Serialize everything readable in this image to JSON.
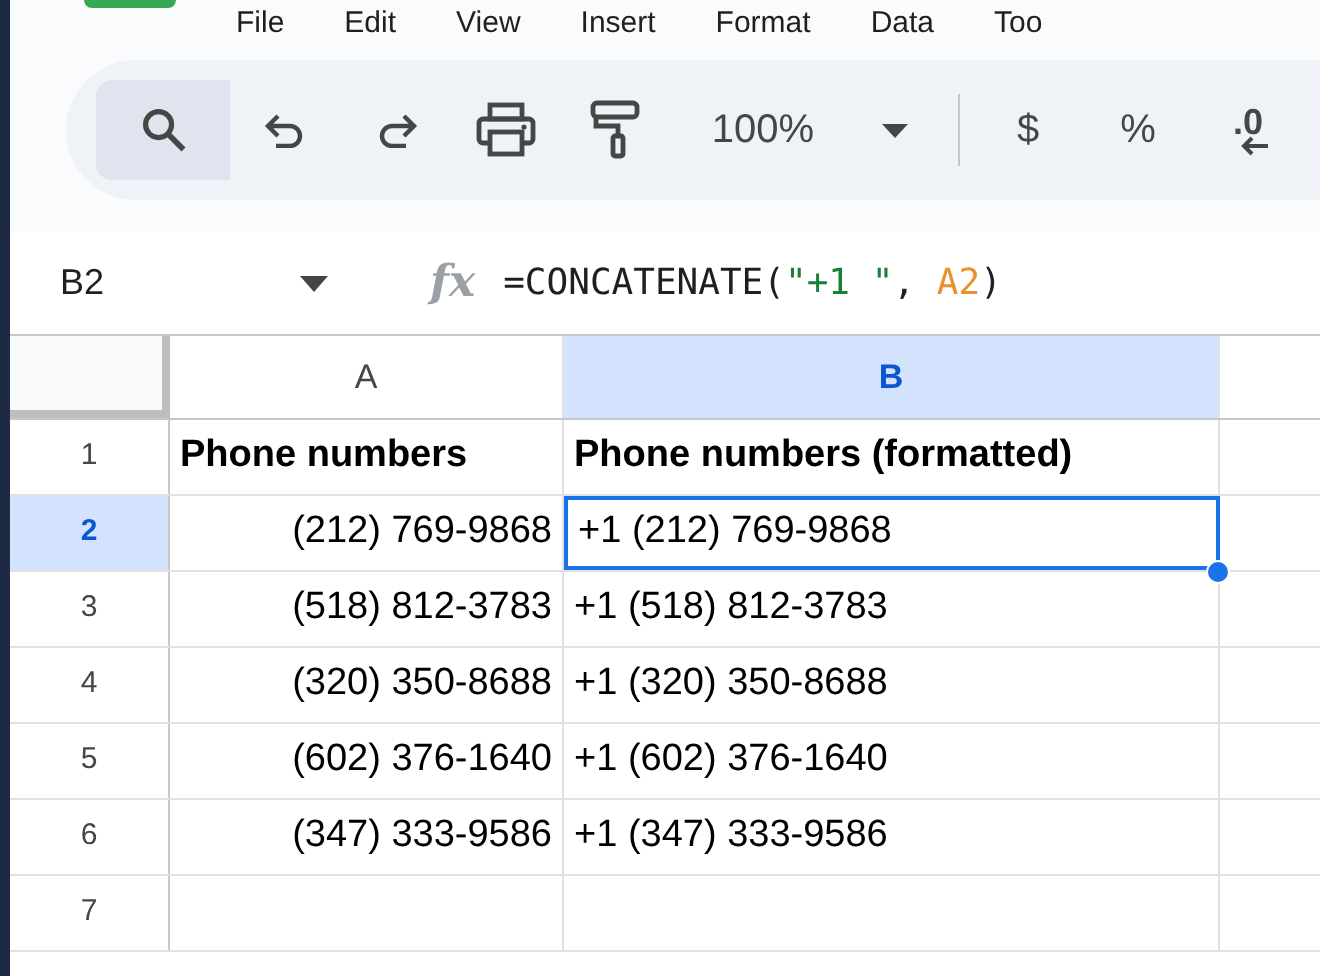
{
  "menu": [
    "File",
    "Edit",
    "View",
    "Insert",
    "Format",
    "Data",
    "Too"
  ],
  "toolbar": {
    "search": {
      "selected": true
    },
    "zoom": "100%",
    "currency": "$",
    "percent": "%",
    "decimal": ".0"
  },
  "name_box": "B2",
  "fx_label": "fx",
  "formula": [
    {
      "text": "=CONCATENATE(",
      "kind": "plain"
    },
    {
      "text": "\"+1 \"",
      "kind": "string"
    },
    {
      "text": ", ",
      "kind": "plain"
    },
    {
      "text": "A2",
      "kind": "reference"
    },
    {
      "text": ")",
      "kind": "plain"
    }
  ],
  "columns": [
    {
      "label": "A",
      "selected": false
    },
    {
      "label": "B",
      "selected": true
    }
  ],
  "rows": [
    {
      "label": "1",
      "selected": false,
      "cells": [
        {
          "text": "Phone numbers",
          "kind": "header",
          "selected": false
        },
        {
          "text": "Phone numbers (formatted)",
          "kind": "header",
          "selected": false
        }
      ]
    },
    {
      "label": "2",
      "selected": true,
      "cells": [
        {
          "text": "(212) 769-9868",
          "kind": "number",
          "selected": false
        },
        {
          "text": "+1 (212) 769-9868",
          "kind": "text",
          "selected": true
        }
      ]
    },
    {
      "label": "3",
      "selected": false,
      "cells": [
        {
          "text": "(518) 812-3783",
          "kind": "number",
          "selected": false
        },
        {
          "text": "+1 (518) 812-3783",
          "kind": "text",
          "selected": false
        }
      ]
    },
    {
      "label": "4",
      "selected": false,
      "cells": [
        {
          "text": "(320) 350-8688",
          "kind": "number",
          "selected": false
        },
        {
          "text": "+1 (320) 350-8688",
          "kind": "text",
          "selected": false
        }
      ]
    },
    {
      "label": "5",
      "selected": false,
      "cells": [
        {
          "text": "(602) 376-1640",
          "kind": "number",
          "selected": false
        },
        {
          "text": "+1 (602) 376-1640",
          "kind": "text",
          "selected": false
        }
      ]
    },
    {
      "label": "6",
      "selected": false,
      "cells": [
        {
          "text": "(347) 333-9586",
          "kind": "number",
          "selected": false
        },
        {
          "text": "+1 (347) 333-9586",
          "kind": "text",
          "selected": false
        }
      ]
    },
    {
      "label": "7",
      "selected": false
    }
  ]
}
